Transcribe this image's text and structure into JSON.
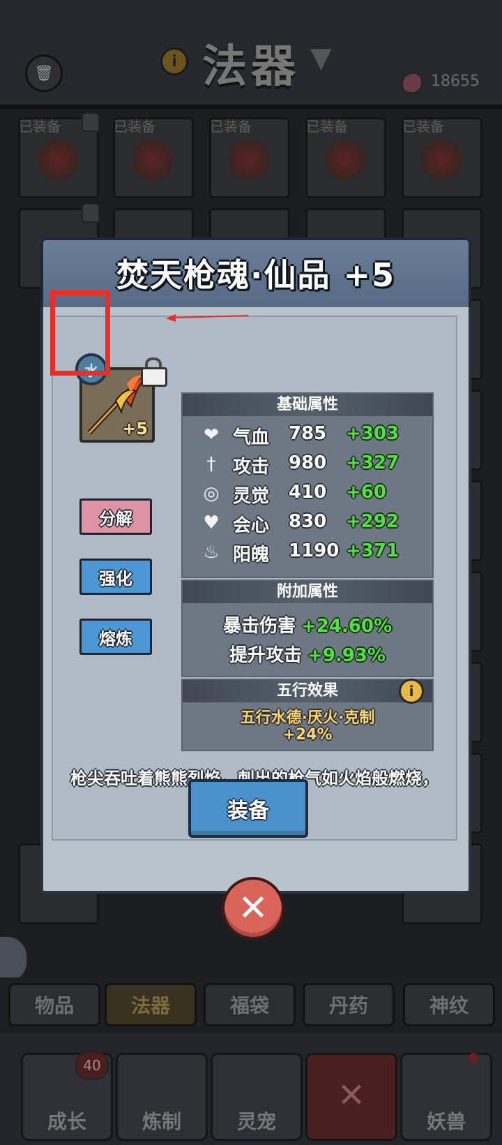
{
  "header": {
    "title": "法器",
    "currency_value": "18655"
  },
  "grid": {
    "equipped_tag": "已装备",
    "slots_equipped_count": 5
  },
  "tabs": [
    {
      "label": "物品",
      "active": false
    },
    {
      "label": "法器",
      "active": true
    },
    {
      "label": "福袋",
      "active": false
    },
    {
      "label": "丹药",
      "active": false
    },
    {
      "label": "神纹",
      "active": false
    }
  ],
  "bottom_nav": {
    "items": [
      {
        "label": "成长",
        "icon": "sword-scroll-icon"
      },
      {
        "label": "炼制",
        "icon": "anvil-icon"
      },
      {
        "label": "灵宠",
        "icon": "pet-icon"
      },
      {
        "label": "",
        "icon": "close-icon"
      },
      {
        "label": "妖兽",
        "icon": "beast-icon"
      }
    ],
    "growth_badge": "40"
  },
  "dialog": {
    "title": "焚天枪魂·仙品 +5",
    "element_badge": "水",
    "item_level": "+5",
    "buttons": {
      "decompose": "分解",
      "strengthen": "强化",
      "smelt": "熔炼",
      "equip": "装备"
    },
    "base_attributes": {
      "heading": "基础属性",
      "rows": [
        {
          "icon": "heart-icon",
          "name": "气血",
          "value": "785",
          "bonus": "+303"
        },
        {
          "icon": "dagger-icon",
          "name": "攻击",
          "value": "980",
          "bonus": "+327"
        },
        {
          "icon": "spirit-eye-icon",
          "name": "灵觉",
          "value": "410",
          "bonus": "+60"
        },
        {
          "icon": "crit-heart-icon",
          "name": "会心",
          "value": "830",
          "bonus": "+292"
        },
        {
          "icon": "flame-soul-icon",
          "name": "阳魄",
          "value": "1190",
          "bonus": "+371"
        }
      ]
    },
    "extra_attributes": {
      "heading": "附加属性",
      "rows": [
        {
          "name": "暴击伤害",
          "value": "+24.60%"
        },
        {
          "name": "提升攻击",
          "value": "+9.93%"
        }
      ]
    },
    "wuxing": {
      "heading": "五行效果",
      "effect": "五行水德·厌火·克制",
      "percent": "+24%"
    },
    "description": "枪尖吞吐着熊熊烈焰，刺出的枪气如火焰般燃烧，焚尽一切。"
  },
  "colors": {
    "bonus_green": "#51e046",
    "wuxing_gold": "#ffd66b",
    "equip_blue": "#4b92cc",
    "decompose_pink": "#dd93a4",
    "annotation_red": "#ef2b26"
  }
}
